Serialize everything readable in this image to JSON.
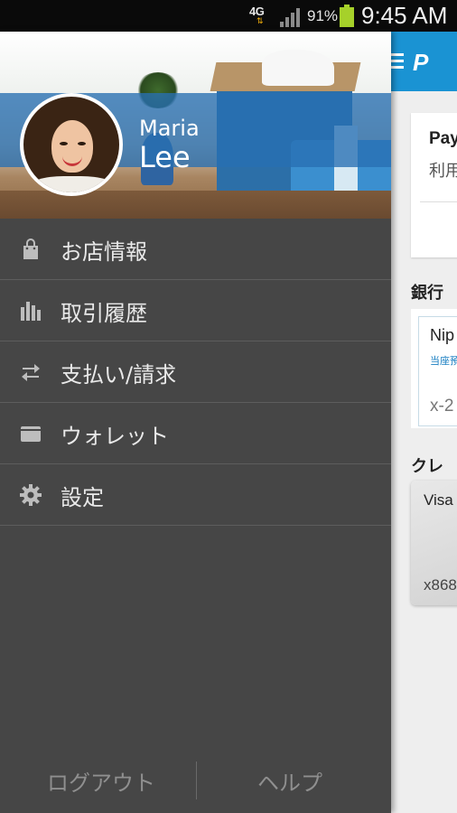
{
  "status_bar": {
    "network": "4G",
    "battery_percent": "91%",
    "time": "9:45 AM",
    "colors": {
      "battery": "#a6d12a",
      "arrows": "#f5b10b"
    }
  },
  "profile": {
    "first_name": "Maria",
    "last_name": "Lee"
  },
  "menu": {
    "items": [
      {
        "label": "お店情報",
        "icon": "shopping-bag-icon"
      },
      {
        "label": "取引履歴",
        "icon": "bar-chart-icon"
      },
      {
        "label": "支払い/請求",
        "icon": "transfer-arrows-icon"
      },
      {
        "label": "ウォレット",
        "icon": "wallet-icon"
      },
      {
        "label": "設定",
        "icon": "gear-icon"
      }
    ]
  },
  "footer": {
    "logout": "ログアウト",
    "help": "ヘルプ"
  },
  "background_app": {
    "card_title": "Pay",
    "card_subtitle": "利用",
    "bank_section": "銀行口",
    "bank_name": "Nip",
    "bank_type": "当座預",
    "bank_number": "x-2",
    "credit_section": "クレジ",
    "visa_label": "Visa",
    "visa_number": "x868",
    "colors": {
      "header": "#1a93d3"
    }
  }
}
